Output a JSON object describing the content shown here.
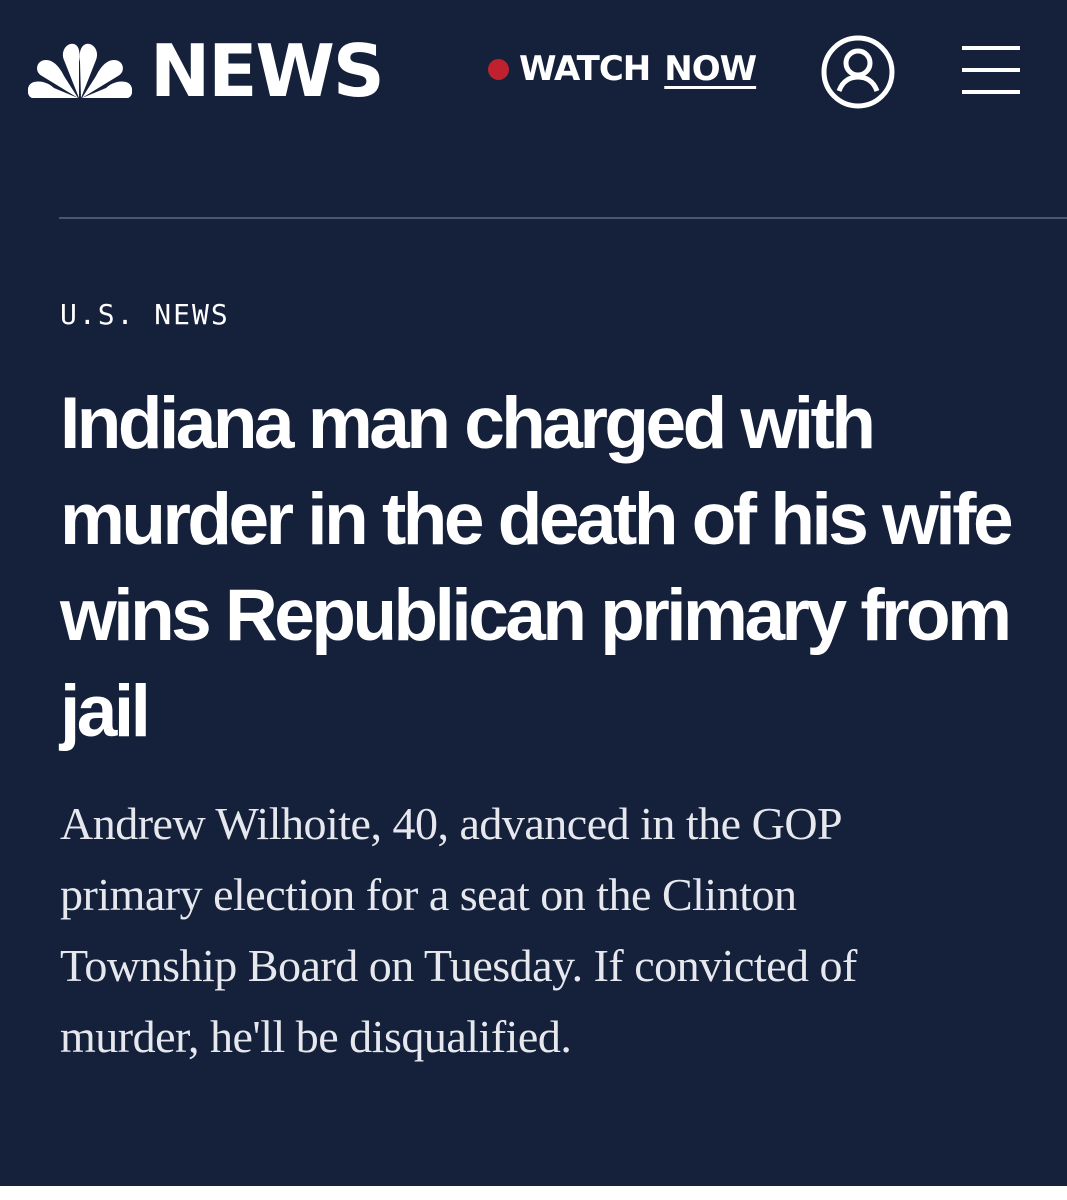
{
  "header": {
    "brand": "NEWS",
    "watch_label": "WATCH",
    "watch_now": "NOW",
    "icons": {
      "logo": "nbc-peacock-icon",
      "live": "live-dot-icon",
      "account": "user-account-icon",
      "menu": "hamburger-menu-icon"
    }
  },
  "article": {
    "section": "U.S. NEWS",
    "headline": "Indiana man charged with murder in the death of his wife wins Republican primary from jail",
    "dek": "Andrew Wilhoite, 40, advanced in the GOP primary election for a seat on the Clinton Township Board on Tuesday. If convicted of murder, he'll be disqualified."
  },
  "colors": {
    "background": "#15213b",
    "text": "#ffffff",
    "live_dot": "#c0212f",
    "divider": "#4a5570"
  }
}
